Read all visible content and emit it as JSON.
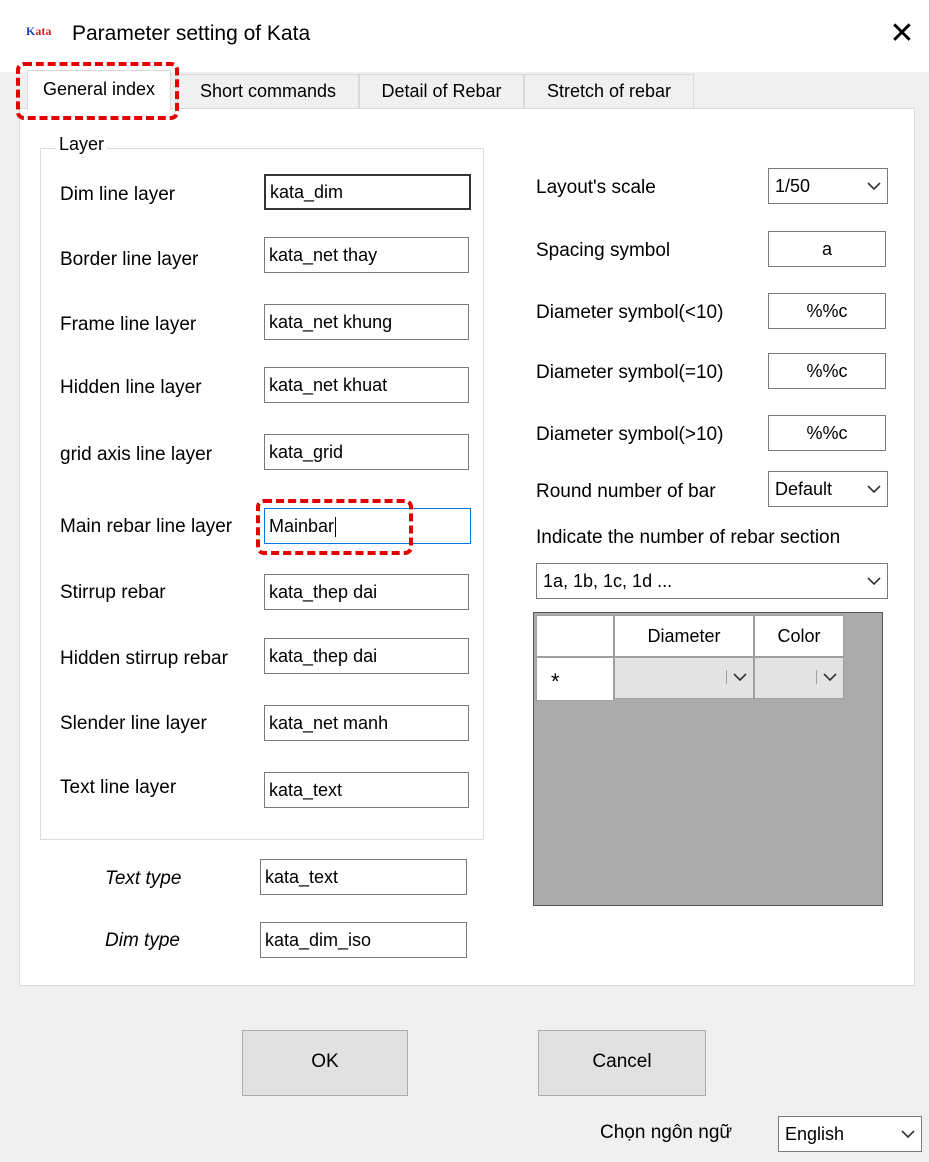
{
  "window": {
    "title": "Parameter setting of Kata",
    "icon_text": [
      "K",
      "ata"
    ],
    "close_glyph": "✕"
  },
  "tabs": [
    "General index",
    "Short commands",
    "Detail of Rebar",
    "Stretch of rebar"
  ],
  "layer_group": {
    "legend": "Layer",
    "rows": [
      {
        "label": "Dim line layer",
        "value": "kata_dim"
      },
      {
        "label": "Border line layer",
        "value": "kata_net thay"
      },
      {
        "label": "Frame line layer",
        "value": "kata_net khung"
      },
      {
        "label": "Hidden line layer",
        "value": "kata_net khuat"
      },
      {
        "label": "grid axis line layer",
        "value": "kata_grid"
      },
      {
        "label": "Main rebar line layer",
        "value": "Mainbar"
      },
      {
        "label": "Stirrup rebar",
        "value": "kata_thep dai"
      },
      {
        "label": "Hidden stirrup rebar",
        "value": "kata_thep dai"
      },
      {
        "label": "Slender line layer",
        "value": "kata_net manh"
      },
      {
        "label": "Text line layer",
        "value": "kata_text"
      }
    ]
  },
  "styles": [
    {
      "label": "Text type",
      "value": "kata_text"
    },
    {
      "label": "Dim type",
      "value": "kata_dim_iso"
    }
  ],
  "settings": {
    "layout_scale": {
      "label": "Layout's scale",
      "value": "1/50"
    },
    "spacing_symbol": {
      "label": "Spacing symbol",
      "value": "a"
    },
    "diam_lt10": {
      "label": "Diameter symbol(<10)",
      "value": "%%c"
    },
    "diam_eq10": {
      "label": "Diameter symbol(=10)",
      "value": "%%c"
    },
    "diam_gt10": {
      "label": "Diameter symbol(>10)",
      "value": "%%c"
    },
    "round_number": {
      "label": "Round number of bar",
      "value": "Default"
    },
    "section_label": "Indicate the number of rebar section",
    "section_value": "1a, 1b, 1c, 1d ..."
  },
  "grid": {
    "columns": [
      "Diameter",
      "Color"
    ],
    "new_row_marker": "*"
  },
  "buttons": {
    "ok": "OK",
    "cancel": "Cancel"
  },
  "language": {
    "label": "Chọn ngôn ngữ",
    "value": "English"
  }
}
